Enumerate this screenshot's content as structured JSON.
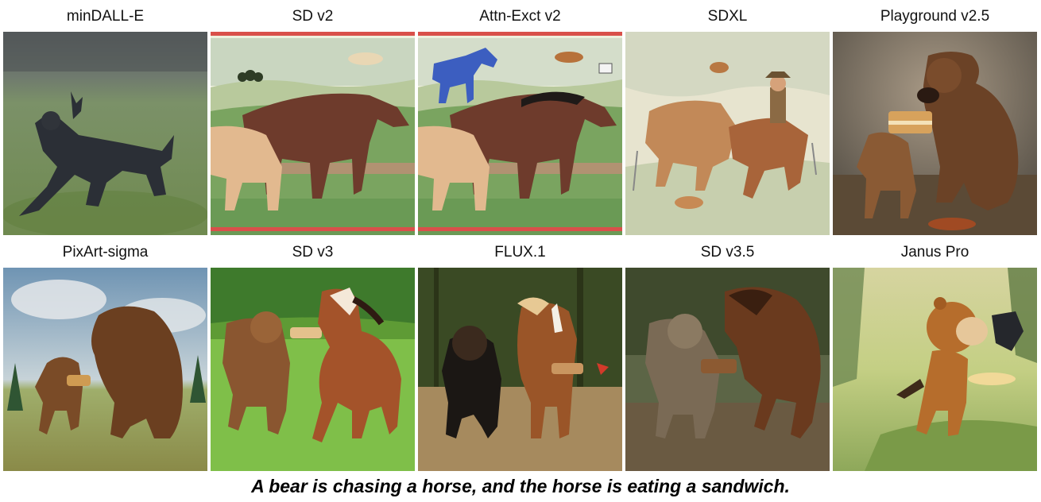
{
  "figure": {
    "caption": "A bear is chasing a horse, and the horse is eating a sandwich.",
    "rows": [
      {
        "panels": [
          {
            "model": "minDALL-E",
            "scene": "dark-horse-field"
          },
          {
            "model": "SD v2",
            "scene": "cartoon-horses"
          },
          {
            "model": "Attn-Exct v2",
            "scene": "cartoon-horses-blue"
          },
          {
            "model": "SDXL",
            "scene": "sketch-rider"
          },
          {
            "model": "Playground v2.5",
            "scene": "bear-sandwich-dark"
          }
        ]
      },
      {
        "panels": [
          {
            "model": "PixArt-sigma",
            "scene": "painted-bears"
          },
          {
            "model": "SD v3",
            "scene": "cartoon-bear-horse-grass"
          },
          {
            "model": "FLUX.1",
            "scene": "photo-bear-horse-forest"
          },
          {
            "model": "SD v3.5",
            "scene": "photo-bear-horse-dirt"
          },
          {
            "model": "Janus Pro",
            "scene": "cartoon-bear-light"
          }
        ]
      }
    ]
  },
  "colors": {
    "background": "#ffffff",
    "text": "#111111"
  }
}
